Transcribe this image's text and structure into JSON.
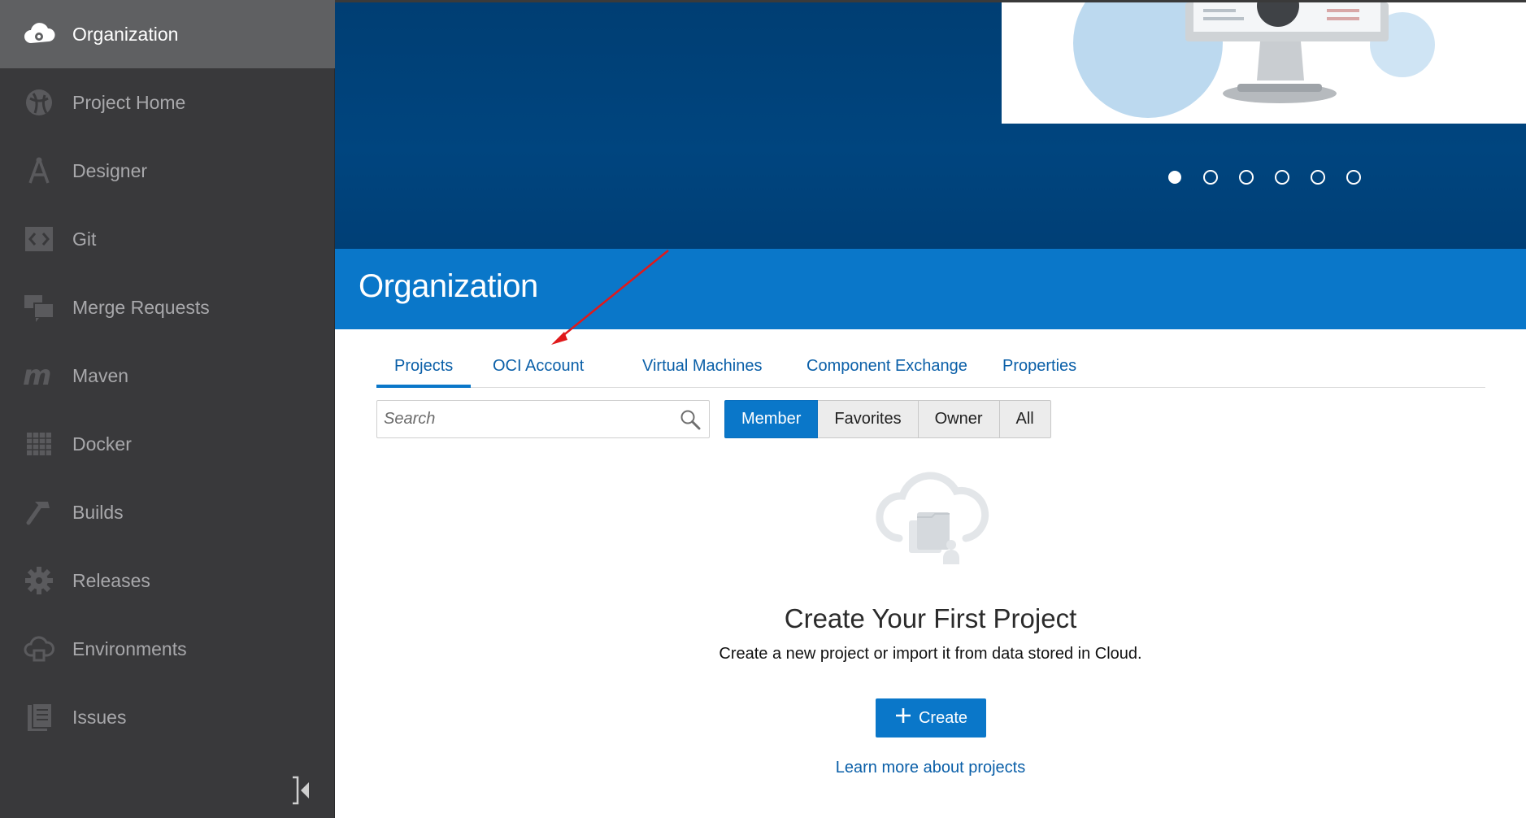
{
  "sidebar": {
    "items": [
      {
        "label": "Organization",
        "icon": "cloud-gear-icon",
        "active": true
      },
      {
        "label": "Project Home",
        "icon": "project-home-icon",
        "active": false
      },
      {
        "label": "Designer",
        "icon": "designer-icon",
        "active": false
      },
      {
        "label": "Git",
        "icon": "git-icon",
        "active": false
      },
      {
        "label": "Merge Requests",
        "icon": "merge-requests-icon",
        "active": false
      },
      {
        "label": "Maven",
        "icon": "maven-icon",
        "active": false
      },
      {
        "label": "Docker",
        "icon": "docker-icon",
        "active": false
      },
      {
        "label": "Builds",
        "icon": "hammer-icon",
        "active": false
      },
      {
        "label": "Releases",
        "icon": "releases-gear-icon",
        "active": false
      },
      {
        "label": "Environments",
        "icon": "environments-icon",
        "active": false
      },
      {
        "label": "Issues",
        "icon": "issues-icon",
        "active": false
      }
    ],
    "collapse_icon": "collapse-sidebar-icon"
  },
  "banner": {
    "slide_count": 6,
    "active_slide": 1
  },
  "header": {
    "title": "Organization"
  },
  "tabs": [
    {
      "label": "Projects",
      "active": true
    },
    {
      "label": "OCI Account",
      "active": false
    },
    {
      "label": "Virtual Machines",
      "active": false
    },
    {
      "label": "Component Exchange",
      "active": false
    },
    {
      "label": "Properties",
      "active": false
    }
  ],
  "search": {
    "placeholder": "Search",
    "value": ""
  },
  "filters": [
    {
      "label": "Member",
      "active": true
    },
    {
      "label": "Favorites",
      "active": false
    },
    {
      "label": "Owner",
      "active": false
    },
    {
      "label": "All",
      "active": false
    }
  ],
  "empty_state": {
    "title": "Create Your First Project",
    "description": "Create a new project or import it from data stored in Cloud.",
    "create_label": "Create",
    "learn_more": "Learn more about projects"
  },
  "colors": {
    "sidebar_bg": "#39393b",
    "sidebar_active": "#5f6062",
    "banner_bg": "#00457f",
    "accent": "#0a77c9",
    "link": "#0a5fa8",
    "annotation_arrow": "#e0191b"
  }
}
